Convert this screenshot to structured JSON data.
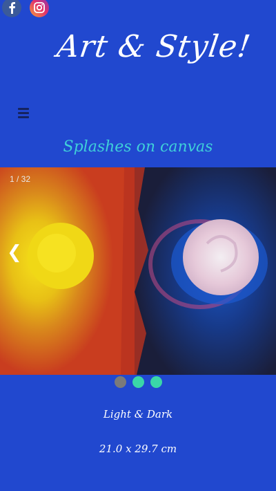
{
  "social": {
    "facebook_icon": "facebook-icon",
    "instagram_icon": "instagram-icon"
  },
  "header": {
    "site_title": "Art & Style!",
    "menu_icon": "hamburger-menu-icon"
  },
  "gallery": {
    "title": "Splashes on canvas",
    "counter": "1 / 32",
    "prev_glyph": "❮",
    "dots": [
      {
        "color": "#7a7a7a",
        "active": false
      },
      {
        "color": "#3ad6a8",
        "active": true
      },
      {
        "color": "#3ad6a8",
        "active": false
      }
    ]
  },
  "artwork": {
    "title": "Light & Dark",
    "size": "21.0 x 29.7 cm"
  },
  "colors": {
    "background": "#2148cf",
    "gallery_title": "#3fd0d9",
    "text": "#ffffff"
  }
}
